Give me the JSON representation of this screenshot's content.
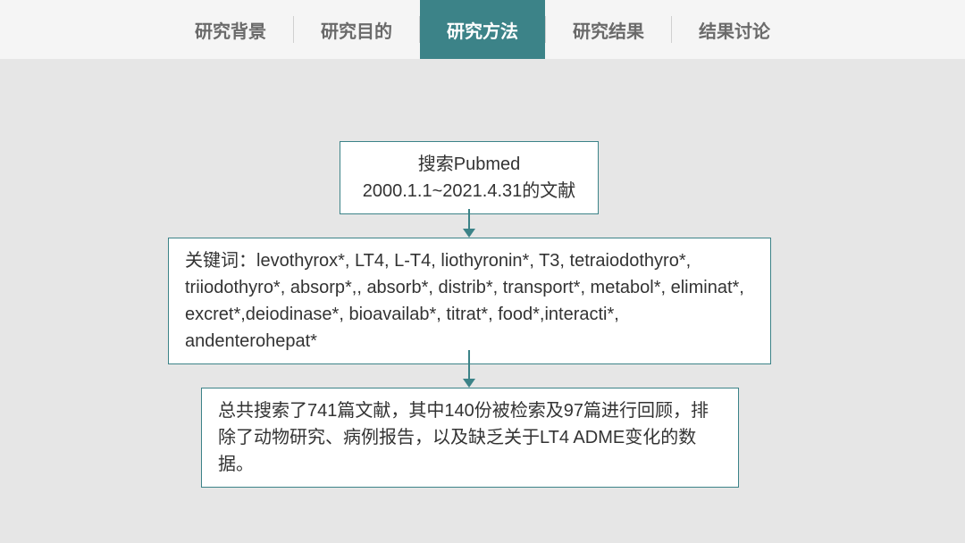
{
  "nav": {
    "tabs": [
      {
        "label": "研究背景",
        "active": false
      },
      {
        "label": "研究目的",
        "active": false
      },
      {
        "label": "研究方法",
        "active": true
      },
      {
        "label": "研究结果",
        "active": false
      },
      {
        "label": "结果讨论",
        "active": false
      }
    ]
  },
  "flow": {
    "box1": {
      "line1": "搜索Pubmed",
      "line2": "2000.1.1~2021.4.31的文献"
    },
    "box2": {
      "text": "关键词：levothyrox*, LT4, L-T4, liothyronin*, T3, tetraiodothyro*, triiodothyro*, absorp*,,  absorb*, distrib*, transport*, metabol*, eliminat*, excret*,deiodinase*, bioavailab*, titrat*, food*,interacti*, andenterohepat*"
    },
    "box3": {
      "text": "总共搜索了741篇文献，其中140份被检索及97篇进行回顾，排除了动物研究、病例报告，以及缺乏关于LT4 ADME变化的数据。"
    }
  }
}
